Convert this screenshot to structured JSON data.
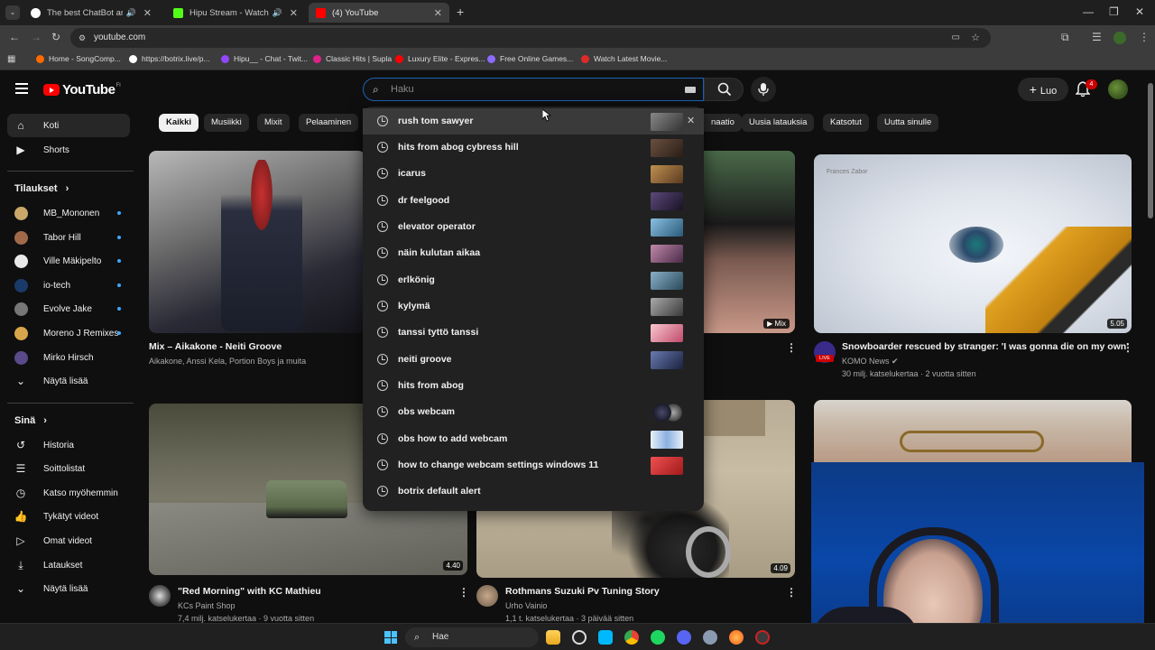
{
  "browser": {
    "tabs": [
      {
        "title": "The best ChatBot and Widg",
        "favicon_color": "#ffffff"
      },
      {
        "title": "Hipu Stream - Watch Live o",
        "favicon_color": "#53fc18"
      },
      {
        "title": "(4) YouTube",
        "favicon_color": "#ff0000"
      }
    ],
    "new_tab": "+",
    "url": "youtube.com",
    "bookmarks": [
      {
        "label": "Home - SongComp...",
        "color": "#ff6a00"
      },
      {
        "label": "https://botrix.live/p...",
        "color": "#ffffff"
      },
      {
        "label": "Hipu__ - Chat - Twit...",
        "color": "#9146ff"
      },
      {
        "label": "Classic Hits | Supla",
        "color": "#e0218a"
      },
      {
        "label": "Luxury Elite - Expres...",
        "color": "#ff0000"
      },
      {
        "label": "Free Online Games...",
        "color": "#8e6bff"
      },
      {
        "label": "Watch Latest Movie...",
        "color": "#e02a2a"
      }
    ]
  },
  "header": {
    "logo_text": "YouTube",
    "logo_country": "FI",
    "search_placeholder": "Haku",
    "create_label": "Luo",
    "notification_count": "4"
  },
  "sidebar": {
    "main": [
      {
        "label": "Koti",
        "icon": "home-icon"
      },
      {
        "label": "Shorts",
        "icon": "shorts-icon"
      }
    ],
    "subs_heading": "Tilaukset",
    "subscriptions": [
      {
        "label": "MB_Mononen",
        "color": "#c9a86a"
      },
      {
        "label": "Tabor Hill",
        "color": "#a06a4a"
      },
      {
        "label": "Ville Mäkipelto",
        "color": "#e8e8e8"
      },
      {
        "label": "io-tech",
        "color": "#1a3a6a"
      },
      {
        "label": "Evolve Jake",
        "color": "#777777"
      },
      {
        "label": "Moreno J Remixes",
        "color": "#d8a64a"
      },
      {
        "label": "Mirko Hirsch",
        "color": "#5a4a8a"
      }
    ],
    "subs_more": "Näytä lisää",
    "you_heading": "Sinä",
    "you_items": [
      {
        "label": "Historia",
        "icon": "history-icon"
      },
      {
        "label": "Soittolistat",
        "icon": "playlists-icon"
      },
      {
        "label": "Katso myöhemmin",
        "icon": "watch-later-icon"
      },
      {
        "label": "Tykätyt videot",
        "icon": "like-icon"
      },
      {
        "label": "Omat videot",
        "icon": "my-videos-icon"
      },
      {
        "label": "Lataukset",
        "icon": "download-icon"
      }
    ],
    "you_more": "Näytä lisää"
  },
  "chips": [
    "Kaikki",
    "Musiikki",
    "Mixit",
    "Pelaaminen",
    "naatio",
    "Uusia latauksia",
    "Katsotut",
    "Uutta sinulle"
  ],
  "suggestions": [
    {
      "text": "rush tom sawyer",
      "thumb": "#5a5a5a"
    },
    {
      "text": "hits from abog cybress hill",
      "thumb": "#4a3a2e"
    },
    {
      "text": "icarus",
      "thumb": "#8a6a3a"
    },
    {
      "text": "dr feelgood",
      "thumb": "#3a2a4a"
    },
    {
      "text": "elevator operator",
      "thumb": "#5a8aaa"
    },
    {
      "text": "näin kulutan aikaa",
      "thumb": "#8a5a7a"
    },
    {
      "text": "erlkönig",
      "thumb": "#4a6a8a"
    },
    {
      "text": "kylymä",
      "thumb": "#6a6a6a"
    },
    {
      "text": "tanssi tyttö tanssi",
      "thumb": "#e8a0b0"
    },
    {
      "text": "neiti groove",
      "thumb": "#3a4a7a"
    },
    {
      "text": "hits from abog",
      "thumb": ""
    },
    {
      "text": "obs webcam",
      "thumb": "#2a2a4a"
    },
    {
      "text": "obs how to add webcam",
      "thumb": "#8ab0e0"
    },
    {
      "text": "how to change webcam settings windows 11",
      "thumb": "#e04040"
    },
    {
      "text": "botrix default alert",
      "thumb": ""
    }
  ],
  "videos": {
    "v1": {
      "title": "Mix – Aikakone - Neiti Groove",
      "meta": "Aikakone, Anssi Kela, Portion Boys ja muita"
    },
    "v2": {
      "mix_badge": "Mix"
    },
    "v3": {
      "title": "Snowboarder rescued by stranger: 'I was gonna die on my own'",
      "channel": "KOMO News",
      "meta": "30 milj. katselukertaa · 2 vuotta sitten",
      "duration": "5.05",
      "thumb_text": "Frances Zabor",
      "live": "LIVE"
    },
    "v4": {
      "title": "\"Red Morning\" with KC Mathieu",
      "channel": "KCs Paint Shop",
      "meta": "7,4 milj. katselukertaa · 9 vuotta sitten",
      "duration": "4.40"
    },
    "v5": {
      "title": "Rothmans Suzuki Pv Tuning Story",
      "channel": "Urho Vainio",
      "meta": "1,1 t. katselukertaa · 3 päivää sitten",
      "duration": "4.09"
    }
  },
  "taskbar": {
    "search_label": "Hae"
  },
  "colors": {
    "accent_red": "#ff0000",
    "focus_blue": "#1c62b9",
    "bg": "#0f0f0f"
  }
}
